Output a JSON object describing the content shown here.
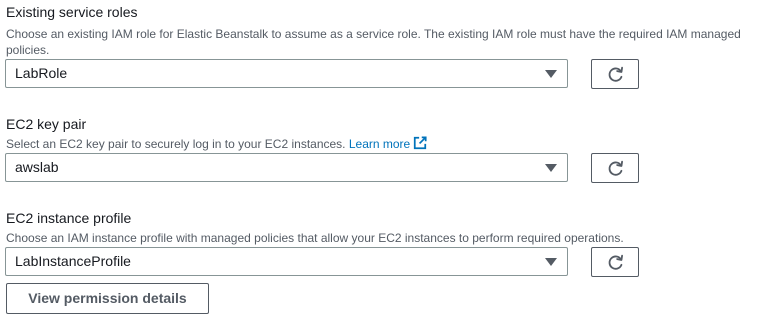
{
  "service_roles": {
    "label": "Existing service roles",
    "description": "Choose an existing IAM role for Elastic Beanstalk to assume as a service role. The existing IAM role must have the required IAM managed policies.",
    "selected": "LabRole"
  },
  "key_pair": {
    "label": "EC2 key pair",
    "description": "Select an EC2 key pair to securely log in to your EC2 instances.",
    "learn_more": "Learn more",
    "selected": "awslab"
  },
  "instance_profile": {
    "label": "EC2 instance profile",
    "description": "Choose an IAM instance profile with managed policies that allow your EC2 instances to perform required operations.",
    "selected": "LabInstanceProfile"
  },
  "view_permission_button": "View permission details",
  "icons": {
    "refresh": "refresh-icon",
    "caret": "caret-down-icon",
    "external_link": "external-link-icon"
  },
  "colors": {
    "link": "#0073bb",
    "text": "#16191f",
    "secondary_text": "#545b64",
    "border": "#879596"
  }
}
